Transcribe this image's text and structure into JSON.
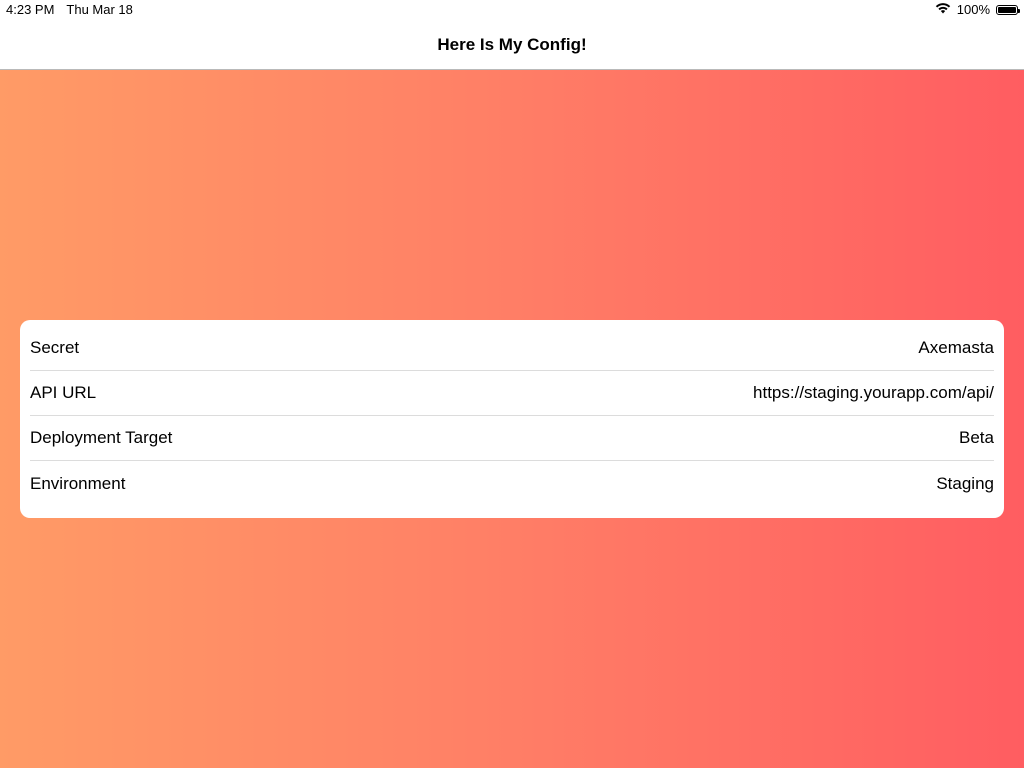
{
  "status_bar": {
    "time": "4:23 PM",
    "date": "Thu Mar 18",
    "battery_text": "100%",
    "battery_level": 1.0
  },
  "nav": {
    "title": "Here Is My Config!"
  },
  "config": {
    "rows": [
      {
        "label": "Secret",
        "value": "Axemasta"
      },
      {
        "label": "API URL",
        "value": "https://staging.yourapp.com/api/"
      },
      {
        "label": "Deployment Target",
        "value": "Beta"
      },
      {
        "label": "Environment",
        "value": "Staging"
      }
    ]
  },
  "colors": {
    "gradient_left": "#ff9b66",
    "gradient_right": "#ff5d61"
  }
}
